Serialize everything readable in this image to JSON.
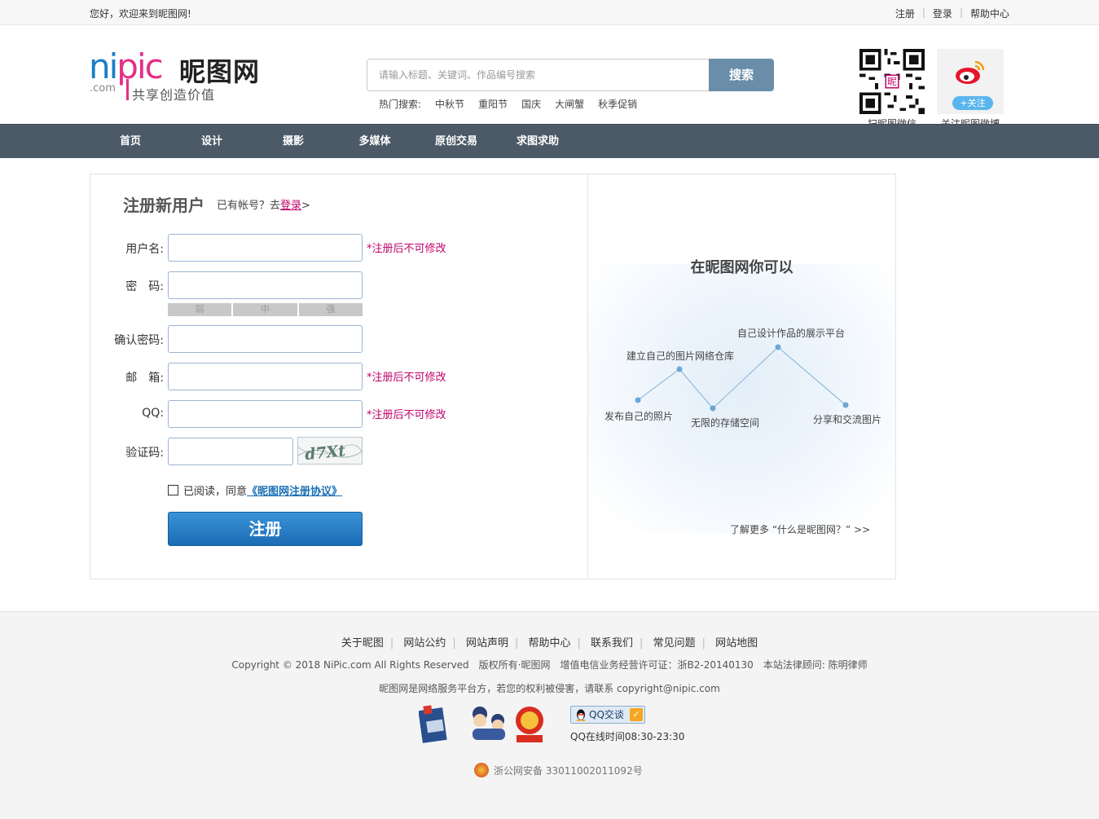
{
  "topbar": {
    "greeting": "您好，欢迎来到昵图网!",
    "links": {
      "register": "注册",
      "login": "登录",
      "help": "帮助中心"
    }
  },
  "logo": {
    "en_n": "ni",
    "en_p": "pic",
    "cn": "昵图网",
    "com": ".com",
    "slogan": "共享创造价值"
  },
  "search": {
    "placeholder": "请输入标题、关键词、作品编号搜索",
    "button": "搜索"
  },
  "hot": {
    "label": "热门搜索:",
    "keywords": [
      "中秋节",
      "重阳节",
      "国庆",
      "大闸蟹",
      "秋季促销"
    ]
  },
  "qr": {
    "caption": "扫昵图微信"
  },
  "weibo": {
    "follow": "+关注",
    "caption": "关注昵图微博"
  },
  "nav": [
    "首页",
    "设计",
    "摄影",
    "多媒体",
    "原创交易",
    "求图求助"
  ],
  "register": {
    "title": "注册新用户",
    "has_account": "已有帐号？去",
    "login_link": "登录",
    "arrow": ">",
    "labels": {
      "username": "用户名:",
      "password": "密　码:",
      "confirm": "确认密码:",
      "email": "邮　箱:",
      "qq": "QQ:",
      "captcha": "验证码:"
    },
    "note": "*注册后不可修改",
    "strength": [
      "弱",
      "中",
      "强"
    ],
    "captcha_text": "d7Xt",
    "agree_text": "已阅读，同意",
    "agree_link": "《昵图网注册协议》",
    "submit": "注册"
  },
  "features": {
    "title": "在昵图网你可以",
    "items": {
      "photos": "发布自己的照片",
      "warehouse": "建立自己的图片网络仓库",
      "storage": "无限的存储空间",
      "showcase": "自己设计作品的展示平台",
      "share": "分享和交流图片"
    },
    "more": "了解更多 “什么是昵图网？” >>"
  },
  "footer": {
    "links": [
      "关于昵图",
      "网站公约",
      "网站声明",
      "帮助中心",
      "联系我们",
      "常见问题",
      "网站地图"
    ],
    "copyright": "Copyright © 2018 NiPic.com All Rights Reserved　版权所有·昵图网　增值电信业务经营许可证：浙B2-20140130　本站法律顾问: 陈明律师",
    "notice": "昵图网是网络服务平台方，若您的权利被侵害，请联系 copyright@nipic.com",
    "qq_button": "QQ交谈",
    "qq_time": "QQ在线时间08:30-23:30",
    "beian": "浙公网安备 33011002011092号"
  }
}
